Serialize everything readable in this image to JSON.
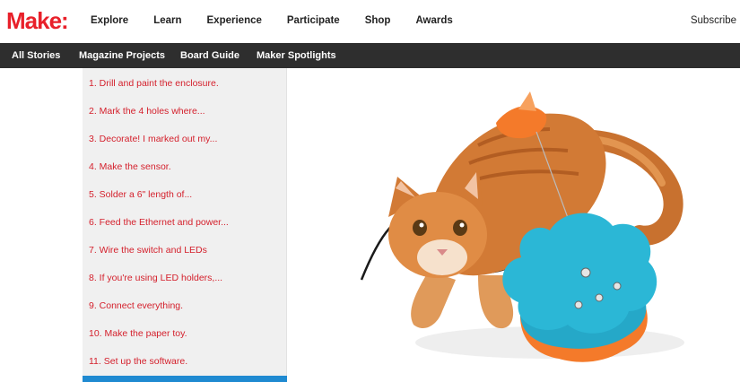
{
  "header": {
    "logo": "Make:",
    "nav": [
      "Explore",
      "Learn",
      "Experience",
      "Participate",
      "Shop",
      "Awards"
    ],
    "subscribe": "Subscribe"
  },
  "subnav": {
    "items": [
      "All Stories",
      "Magazine Projects",
      "Board Guide",
      "Maker Spotlights"
    ]
  },
  "steps": [
    "1. Drill and paint the enclosure.",
    "2. Mark the 4 holes where...",
    "3. Decorate! I marked out my...",
    "4. Make the sensor.",
    "5. Solder a 6\" length of...",
    "6. Feed the Ethernet and power...",
    "7. Wire the switch and LEDs",
    "8. If you're using LED holders,...",
    "9. Connect everything.",
    "10. Make the paper toy.",
    "11. Set up the software."
  ],
  "colors": {
    "brand_red": "#e8202a",
    "link_red": "#d4202c",
    "subnav_bg": "#2e2e2e",
    "active_blue": "#1f8ad1",
    "toy_blue": "#2bb7d6",
    "toy_orange": "#f47a2a"
  },
  "hero": {
    "icon": "cat-with-cloud-shaped-toy-photo"
  }
}
